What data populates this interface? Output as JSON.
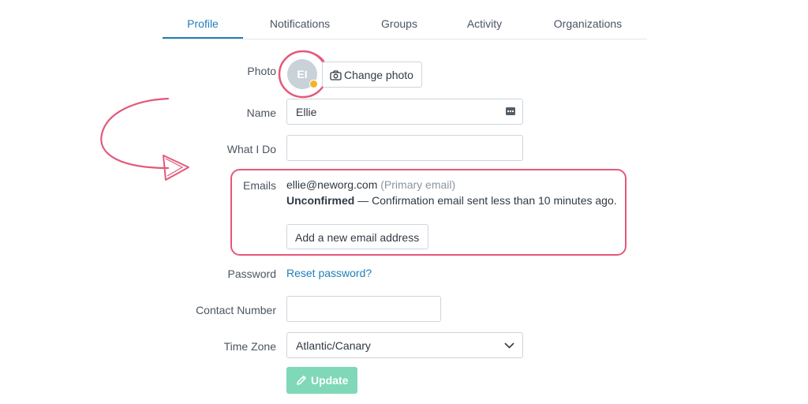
{
  "tabs": [
    {
      "label": "Profile",
      "active": true
    },
    {
      "label": "Notifications"
    },
    {
      "label": "Groups"
    },
    {
      "label": "Activity"
    },
    {
      "label": "Organizations"
    }
  ],
  "profile": {
    "photo_label": "Photo",
    "avatar_initials": "EI",
    "change_photo_label": "Change photo",
    "name_label": "Name",
    "name_value": "Ellie",
    "what_i_do_label": "What I Do",
    "what_i_do_value": "",
    "emails_label": "Emails",
    "email_address": "ellie@neworg.com",
    "email_primary_note": "(Primary email)",
    "email_status": "Unconfirmed",
    "email_status_detail": " — Confirmation email sent less than 10 minutes ago.",
    "add_email_label": "Add a new email address",
    "password_label": "Password",
    "reset_password_label": "Reset password?",
    "contact_label": "Contact Number",
    "contact_value": "",
    "timezone_label": "Time Zone",
    "timezone_value": "Atlantic/Canary",
    "update_label": "Update"
  },
  "colors": {
    "accent": "#1f7fb8",
    "highlight": "#e4587a",
    "update_button": "#7fd8b8",
    "avatar_bg": "#c9d1d9",
    "warning_dot": "#f0b429"
  },
  "icons": [
    "camera-icon",
    "contact-card-icon",
    "chevron-down-icon",
    "pencil-icon",
    "warning-dot-icon",
    "annotation-arrow"
  ]
}
